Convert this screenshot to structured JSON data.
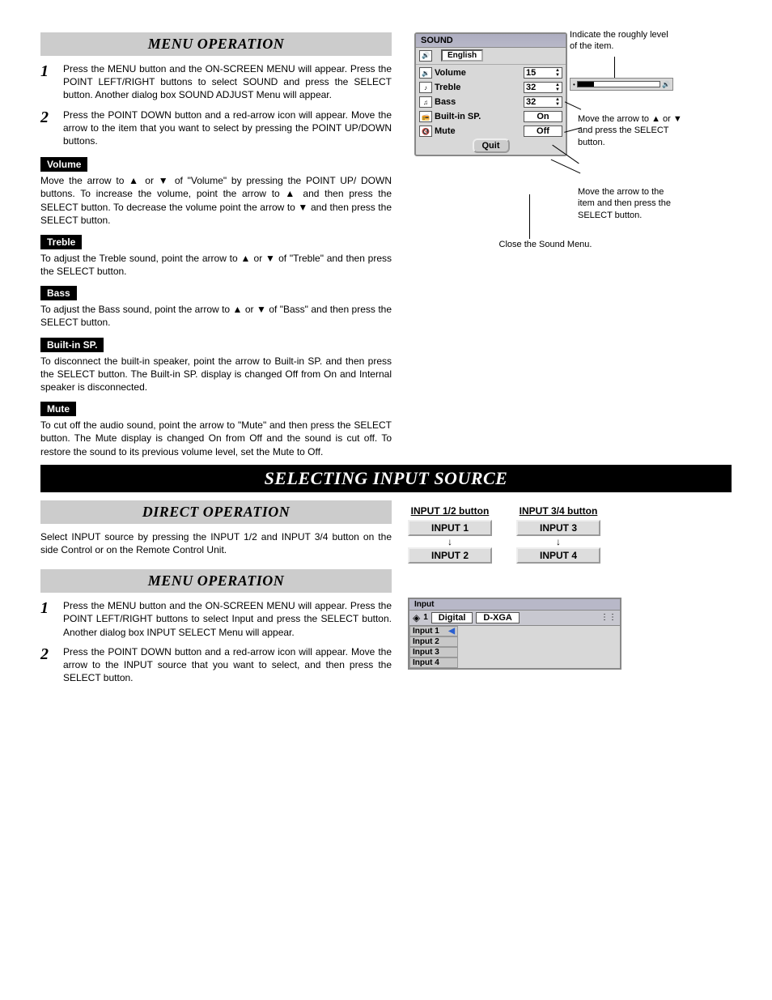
{
  "sections": {
    "menu_op1": "MENU OPERATION",
    "selecting": "SELECTING INPUT SOURCE",
    "direct_op": "DIRECT OPERATION",
    "menu_op2": "MENU OPERATION"
  },
  "steps1": [
    {
      "num": "1",
      "text": "Press the MENU button and the ON-SCREEN MENU will appear.  Press the POINT LEFT/RIGHT buttons to select SOUND and press the SELECT button.  Another dialog box SOUND ADJUST Menu will appear."
    },
    {
      "num": "2",
      "text": "Press the POINT DOWN button and a red-arrow icon will appear.  Move the arrow to the item that you want to select by pressing the POINT UP/DOWN buttons."
    }
  ],
  "items": [
    {
      "label": "Volume",
      "text": "Move the arrow to ▲ or ▼ of \"Volume\" by pressing the POINT UP/ DOWN buttons.  To increase the volume, point the arrow to ▲ and then press the SELECT button.  To decrease the volume point the arrow to ▼ and then press the SELECT button."
    },
    {
      "label": "Treble",
      "text": "To adjust the Treble sound, point the arrow to ▲ or ▼ of \"Treble\" and then press the SELECT button."
    },
    {
      "label": "Bass",
      "text": "To adjust the Bass sound, point the arrow to ▲ or ▼ of \"Bass\" and then press the SELECT button."
    },
    {
      "label": "Built-in SP.",
      "text": "To disconnect the built-in speaker, point the arrow to Built-in SP. and then press the SELECT button. The Built-in SP. display is changed Off from On and Internal speaker is disconnected."
    },
    {
      "label": "Mute",
      "text": "To cut off the audio sound, point the arrow to \"Mute\" and then press the SELECT button.  The Mute display is changed On from Off and the sound is cut off.  To restore the sound to its previous volume level, set the Mute to Off."
    }
  ],
  "direct_text": "Select INPUT source by pressing the INPUT 1/2 and INPUT 3/4 button on the side Control or on the Remote Control Unit.",
  "steps2": [
    {
      "num": "1",
      "text": "Press the MENU button and the ON-SCREEN MENU will appear.  Press the POINT LEFT/RIGHT buttons to select Input and press the SELECT button.  Another dialog box INPUT SELECT Menu will appear."
    },
    {
      "num": "2",
      "text": "Press the POINT DOWN button and a red-arrow icon will appear.  Move the arrow to the INPUT source that you want to select, and then press the SELECT button."
    }
  ],
  "sound_dialog": {
    "title": "SOUND",
    "lang": "English",
    "rows": [
      {
        "label": "Volume",
        "value": "15",
        "spinner": true
      },
      {
        "label": "Treble",
        "value": "32",
        "spinner": true
      },
      {
        "label": "Bass",
        "value": "32",
        "spinner": true
      },
      {
        "label": "Built-in SP.",
        "value": "On",
        "spinner": false
      },
      {
        "label": "Mute",
        "value": "Off",
        "spinner": false
      }
    ],
    "quit": "Quit"
  },
  "annotations": {
    "a1": "Indicate the roughly level of the item.",
    "a2": "Move the arrow to ▲ or ▼ and press the SELECT button.",
    "a3": "Move the arrow to the item and then press the SELECT button.",
    "a4": "Close the Sound Menu."
  },
  "input_buttons": {
    "col1": {
      "header": "INPUT 1/2 button",
      "b1": "INPUT 1",
      "b2": "INPUT 2"
    },
    "col2": {
      "header": "INPUT 3/4 button",
      "b1": "INPUT 3",
      "b2": "INPUT 4"
    }
  },
  "input_menu": {
    "title": "Input",
    "num": "1",
    "box1": "Digital",
    "box2": "D-XGA",
    "items": [
      "Input 1",
      "Input 2",
      "Input 3",
      "Input 4"
    ]
  }
}
